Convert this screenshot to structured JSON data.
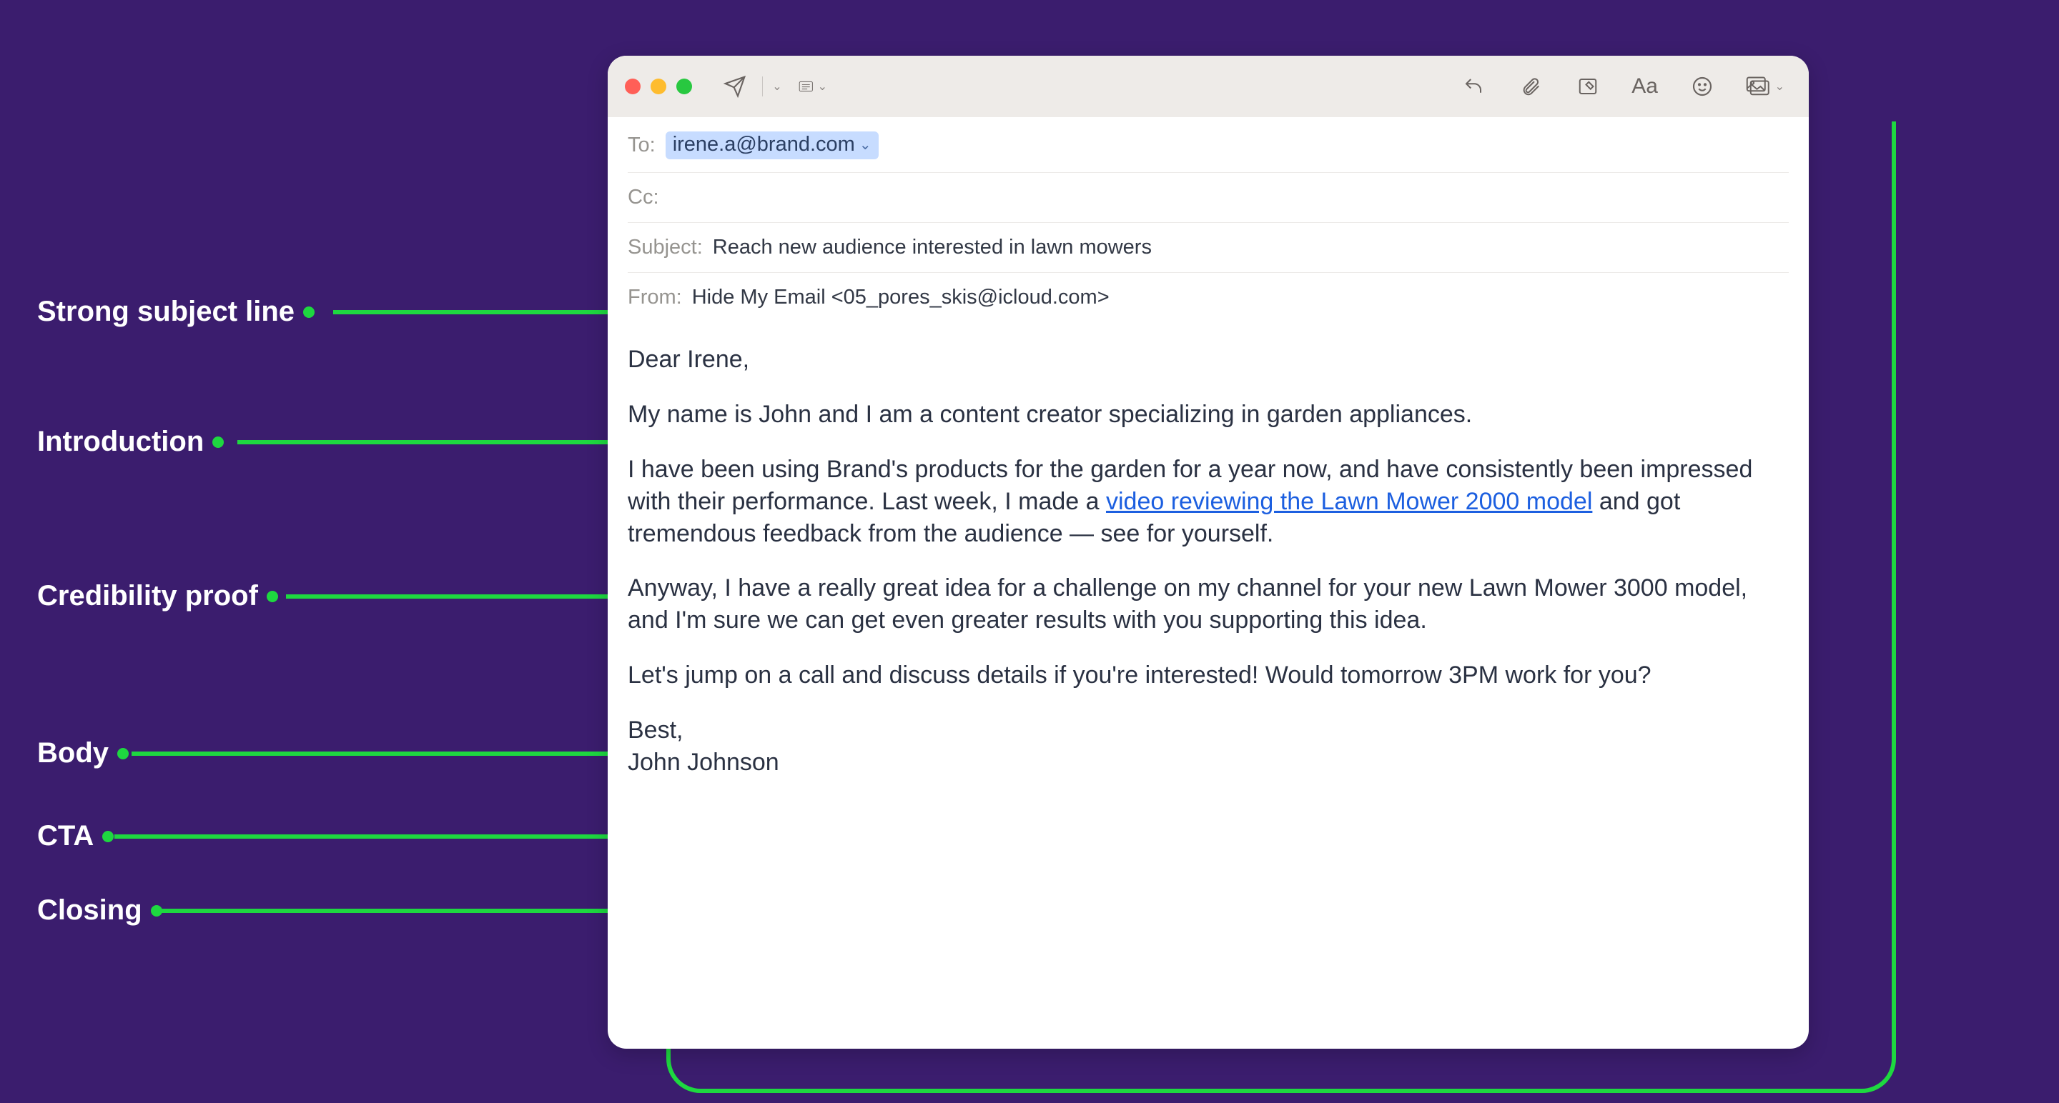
{
  "annotations": {
    "subject": "Strong subject line",
    "intro": "Introduction",
    "proof": "Credibility proof",
    "body": "Body",
    "cta": "CTA",
    "closing": "Closing"
  },
  "mail": {
    "header": {
      "to_label": "To:",
      "to_value": "irene.a@brand.com",
      "cc_label": "Cc:",
      "subject_label": "Subject:",
      "subject_value": "Reach new audience interested in lawn mowers",
      "from_label": "From:",
      "from_value": "Hide My Email <05_pores_skis@icloud.com>"
    },
    "body": {
      "greeting": "Dear Irene,",
      "intro": "My name is John and I am a content creator specializing in garden appliances.",
      "proof_before": "I have been using Brand's products for the garden for a year now, and have consistently been impressed with their performance. Last week, I made a ",
      "proof_link": "video reviewing the Lawn Mower 2000 model",
      "proof_after": " and got tremendous feedback from the audience — see for yourself.",
      "main": "Anyway, I have a really great idea for a challenge on my channel for your new Lawn Mower 3000 model, and I'm sure we can get even greater results with you supporting this idea.",
      "cta": "Let's jump on a call and discuss details if you're interested! Would tomorrow 3PM work for you?",
      "closing1": "Best,",
      "closing2": "John Johnson"
    }
  }
}
